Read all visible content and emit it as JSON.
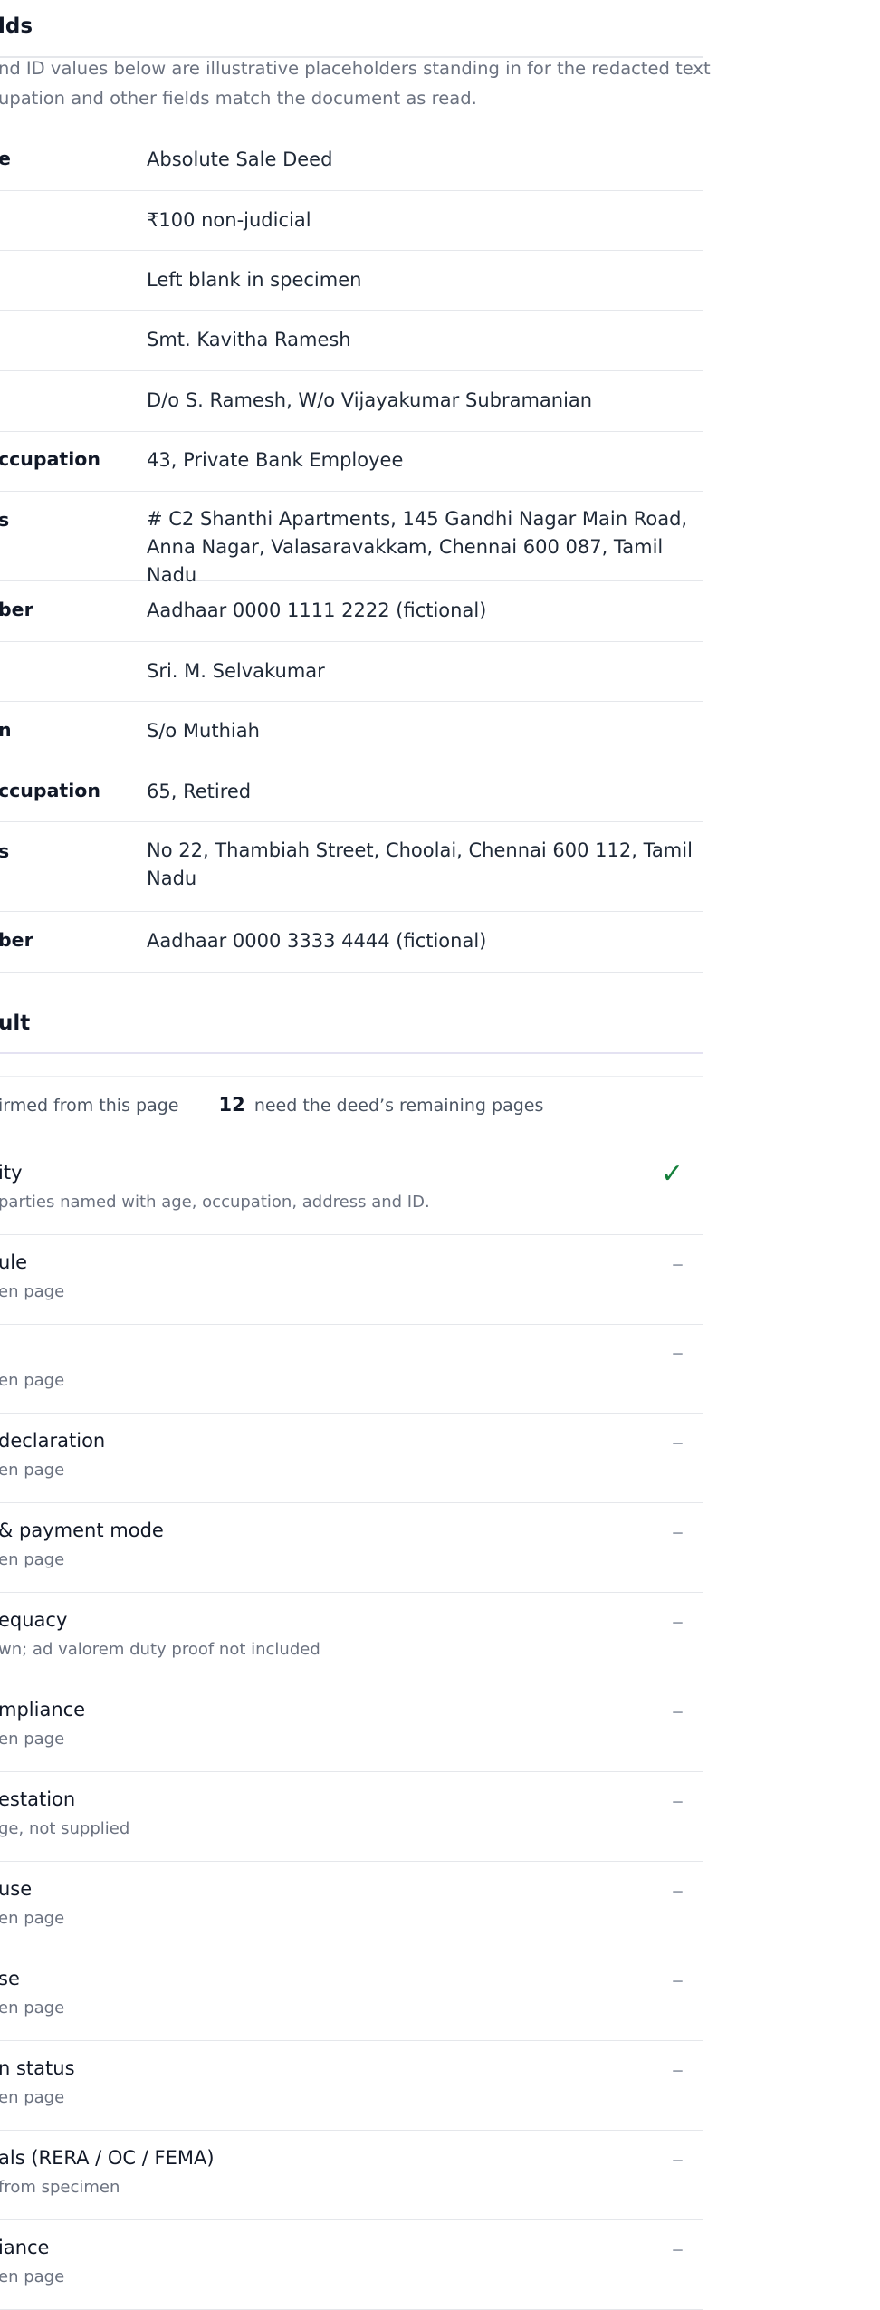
{
  "fields_section": {
    "title": "lds",
    "note_lines": [
      "nd ID values below are illustrative placeholders standing in for the redacted text",
      "upation and other fields match the document as read."
    ],
    "rows": [
      {
        "label": "e",
        "value": "Absolute Sale Deed"
      },
      {
        "label": "",
        "value": "₹100 non-judicial"
      },
      {
        "label": "",
        "value": "Left blank in specimen"
      },
      {
        "label": "",
        "value": "Smt. Kavitha Ramesh"
      },
      {
        "label": "",
        "value": "D/o S. Ramesh, W/o Vijayakumar Subramanian"
      },
      {
        "label": "ccupation",
        "value": "43, Private Bank Employee"
      },
      {
        "label": "s",
        "value": "# C2 Shanthi Apartments, 145 Gandhi Nagar Main Road, Anna Nagar, Valasaravakkam, Chennai 600 087, Tamil Nadu"
      },
      {
        "label": "ber",
        "value": "Aadhaar 0000 1111 2222 (fictional)"
      },
      {
        "label": "",
        "value": "Sri. M. Selvakumar"
      },
      {
        "label": "n",
        "value": "S/o Muthiah"
      },
      {
        "label": "ccupation",
        "value": "65, Retired"
      },
      {
        "label": "s",
        "value": "No 22, Thambiah Street, Choolai, Chennai 600 112, Tamil Nadu"
      },
      {
        "label": "ber",
        "value": "Aadhaar 0000 3333 4444 (fictional)"
      }
    ]
  },
  "result_section": {
    "title": "ult",
    "summary": {
      "confirmed_text": "irmed from this page",
      "pending_count": "12",
      "pending_text": "need the deed’s remaining pages"
    },
    "checks": [
      {
        "title": "ity",
        "sub": "parties named with age, occupation, address and ID.",
        "status": "✓",
        "status_kind": "ok"
      },
      {
        "title": "ule",
        "sub": "en page",
        "status": "–",
        "status_kind": "pending"
      },
      {
        "title": "",
        "sub": "en page",
        "status": "–",
        "status_kind": "pending"
      },
      {
        "title": "declaration",
        "sub": "en page",
        "status": "–",
        "status_kind": "pending"
      },
      {
        "title": "& payment mode",
        "sub": "en page",
        "status": "–",
        "status_kind": "pending"
      },
      {
        "title": "equacy",
        "sub": "wn; ad valorem duty proof not included",
        "status": "–",
        "status_kind": "pending"
      },
      {
        "title": "mpliance",
        "sub": "en page",
        "status": "–",
        "status_kind": "pending"
      },
      {
        "title": "estation",
        "sub": "ge, not supplied",
        "status": "–",
        "status_kind": "pending"
      },
      {
        "title": "use",
        "sub": "en page",
        "status": "–",
        "status_kind": "pending"
      },
      {
        "title": "se",
        "sub": "en page",
        "status": "–",
        "status_kind": "pending"
      },
      {
        "title": "n status",
        "sub": "en page",
        "status": "–",
        "status_kind": "pending"
      },
      {
        "title": "als (RERA / OC / FEMA)",
        "sub": "from specimen",
        "status": "–",
        "status_kind": "pending"
      },
      {
        "title": "iance",
        "sub": "en page",
        "status": "–",
        "status_kind": "pending"
      }
    ]
  },
  "colors": {
    "ok": "#16803c",
    "pending": "#9ca3af",
    "divider": "#e5e7eb",
    "accent_rule": "#e4e2f2"
  }
}
